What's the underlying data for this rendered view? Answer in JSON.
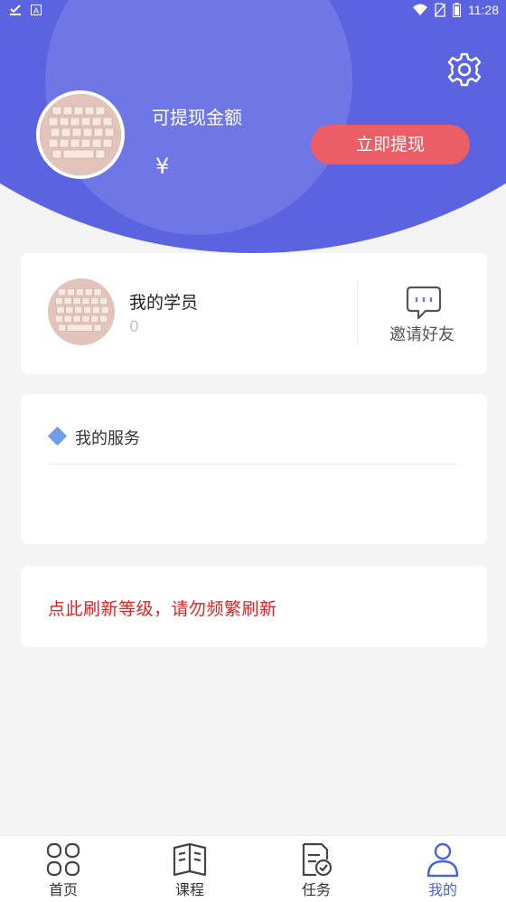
{
  "status_bar": {
    "time": "11:28",
    "icons": [
      "download-done-icon",
      "a-badge-icon",
      "wifi-icon",
      "no-sim-icon",
      "battery-icon"
    ]
  },
  "header": {
    "balance_label": "可提现金额",
    "balance_currency": "¥",
    "withdraw_button": "立即提现",
    "settings_icon": "gear-icon"
  },
  "students_card": {
    "title": "我的学员",
    "count": "0",
    "invite_label": "邀请好友",
    "invite_icon": "chat-bubble-icon"
  },
  "services_card": {
    "title": "我的服务"
  },
  "refresh_card": {
    "text": "点此刷新等级，请勿频繁刷新"
  },
  "tabbar": {
    "tabs": [
      {
        "label": "首页",
        "icon": "grid-icon"
      },
      {
        "label": "课程",
        "icon": "book-icon"
      },
      {
        "label": "任务",
        "icon": "task-icon"
      },
      {
        "label": "我的",
        "icon": "person-icon",
        "active": true
      }
    ]
  },
  "colors": {
    "primary": "#5b63e0",
    "accent_button": "#ec5e66",
    "active_tab": "#4a63d8",
    "warning_text": "#dd2424",
    "diamond": "#6f9de8"
  }
}
